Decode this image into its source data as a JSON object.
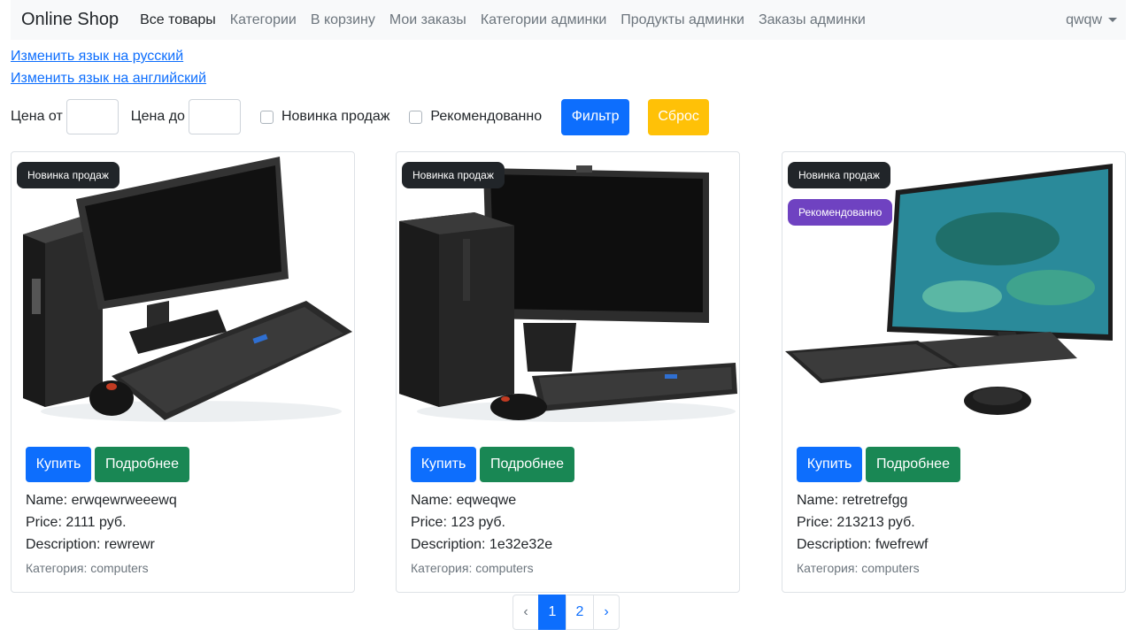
{
  "navbar": {
    "brand": "Online Shop",
    "links": [
      "Все товары",
      "Категории",
      "В корзину",
      "Мои заказы",
      "Категории админки",
      "Продукты админки",
      "Заказы админки"
    ],
    "user": "qwqw"
  },
  "lang": {
    "ru": "Изменить язык на русский",
    "en": "Изменить язык на английский"
  },
  "filter": {
    "price_from_label": "Цена от",
    "price_to_label": "Цена до",
    "price_from_value": "",
    "price_to_value": "",
    "new_label": "Новинка продаж",
    "recommended_label": "Рекомендованно",
    "new_checked": false,
    "recommended_checked": false,
    "filter_button": "Фильтр",
    "reset_button": "Сброс"
  },
  "products": [
    {
      "badges": [
        "Новинка продаж"
      ],
      "buy": "Купить",
      "more": "Подробнее",
      "name": "Name: erwqewrweeewq",
      "price": "Price: 2111 руб.",
      "description": "Description: rewrewr",
      "category": "Категория: computers"
    },
    {
      "badges": [
        "Новинка продаж"
      ],
      "buy": "Купить",
      "more": "Подробнее",
      "name": "Name: eqweqwe",
      "price": "Price: 123 руб.",
      "description": "Description: 1e32e32e",
      "category": "Категория: computers"
    },
    {
      "badges": [
        "Новинка продаж",
        "Рекомендованно"
      ],
      "buy": "Купить",
      "more": "Подробнее",
      "name": "Name: retretrefgg",
      "price": "Price: 213213 руб.",
      "description": "Description: fwefrewf",
      "category": "Категория: computers"
    }
  ],
  "pagination": {
    "prev": "‹",
    "pages": [
      "1",
      "2"
    ],
    "current": "1",
    "next": "›"
  },
  "colors": {
    "primary": "#0d6efd",
    "warning": "#ffc107",
    "success": "#198754",
    "badge_dark": "#212529",
    "badge_purple": "#6f42c1",
    "navbar_bg": "#f8f9fa"
  }
}
